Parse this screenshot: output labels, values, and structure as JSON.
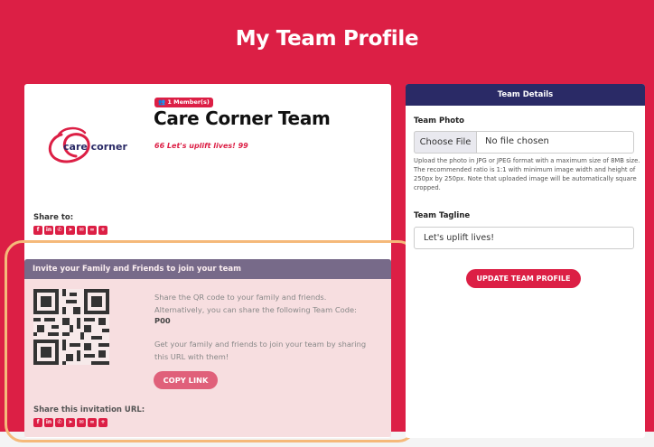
{
  "page": {
    "title": "My Team Profile"
  },
  "team": {
    "member_badge": "👥 1 Member(s)",
    "name": "Care Corner Team",
    "tagline_display": "66 Let's uplift lives! 99",
    "logo_text": "care corner"
  },
  "share": {
    "label": "Share to:",
    "icons": [
      "facebook-icon",
      "linkedin-icon",
      "whatsapp-icon",
      "telegram-icon",
      "email-icon",
      "link-icon",
      "plus-icon"
    ]
  },
  "invite": {
    "header": "Invite your Family and Friends to join your team",
    "text1": "Share the QR code to your family and friends. Alternatively, you can share the following Team Code:",
    "code": "P00",
    "text2": "Get your family and friends to join your team by sharing this URL with them!",
    "copy_button": "COPY LINK",
    "share_url_label": "Share this invitation URL:"
  },
  "details": {
    "header": "Team Details",
    "photo_label": "Team Photo",
    "file_button": "Choose File",
    "file_status": "No file chosen",
    "help_text": "Upload the photo in JPG or JPEG format with a maximum size of 8MB size. The recommended ratio is 1:1 with minimum image width and height of 250px by 250px. Note that uploaded image will be automatically square cropped.",
    "tagline_label": "Team Tagline",
    "tagline_value": "Let's uplift lives!",
    "update_button": "UPDATE TEAM PROFILE"
  },
  "colors": {
    "brand": "#dc1f45",
    "panel_header": "#2a2a66",
    "invite_header": "#6d6d8d",
    "highlight": "#f5b97a"
  }
}
